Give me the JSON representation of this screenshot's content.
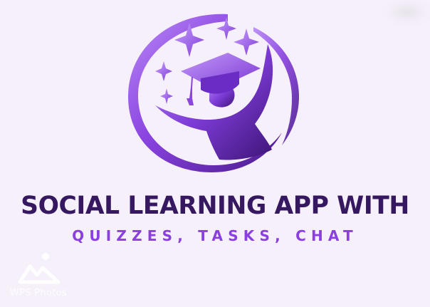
{
  "artwork": {
    "title": "SOCIAL LEARNING APP WITH",
    "subtitle": "QUIZZES, TASKS, CHAT",
    "logo_icon": "graduate-with-cap-and-stars-icon"
  },
  "watermark": {
    "text": "WPS Photos",
    "icon": "wps-photos-logo-icon"
  },
  "colors": {
    "background": "#f6f0fb",
    "title": "#35185f",
    "subtitle": "#8a3fe0",
    "purple_light": "#b27ef5",
    "purple_mid": "#8b46e0",
    "purple_dark": "#4a1a8c"
  }
}
